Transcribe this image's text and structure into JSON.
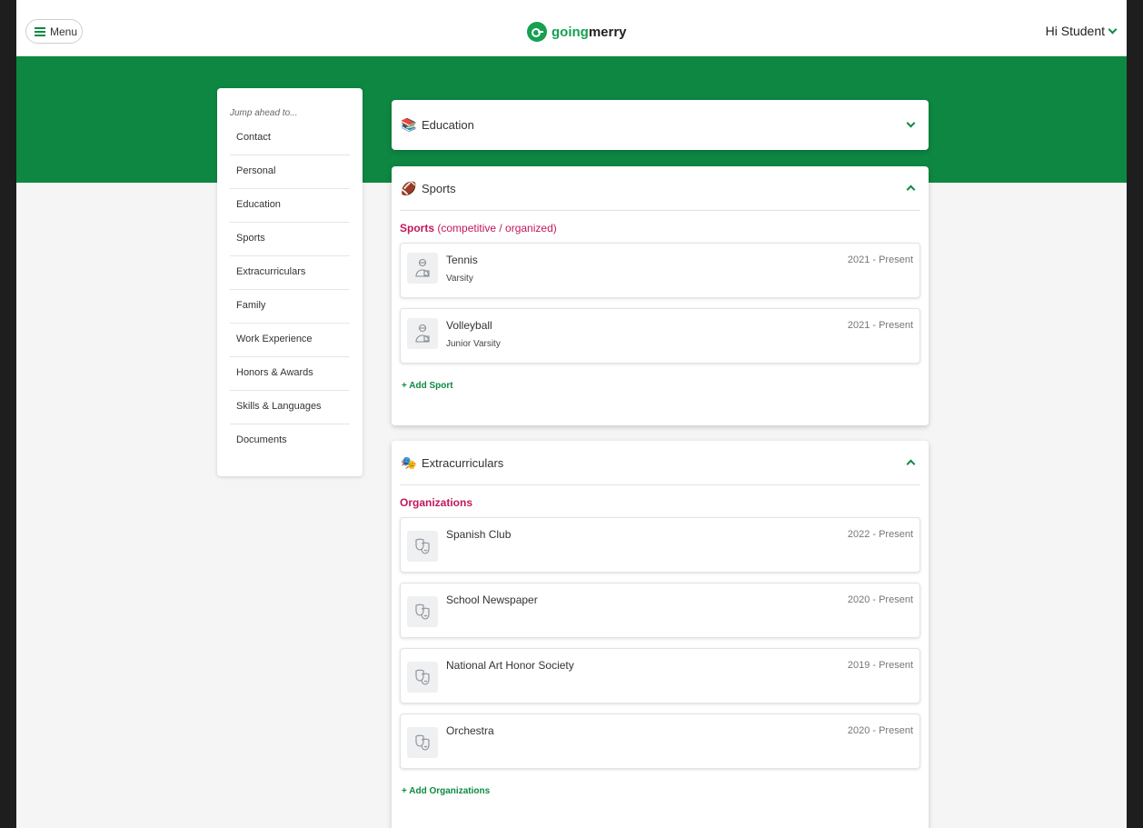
{
  "header": {
    "menu_label": "Menu",
    "logo_going": "going",
    "logo_merry": "merry",
    "greeting": "Hi Student"
  },
  "sidenav": {
    "heading": "Jump ahead to...",
    "items": [
      {
        "label": "Contact"
      },
      {
        "label": "Personal"
      },
      {
        "label": "Education"
      },
      {
        "label": "Sports"
      },
      {
        "label": "Extracurriculars"
      },
      {
        "label": "Family"
      },
      {
        "label": "Work Experience"
      },
      {
        "label": "Honors & Awards"
      },
      {
        "label": "Skills & Languages"
      },
      {
        "label": "Documents"
      }
    ]
  },
  "education": {
    "title": "Education",
    "icon": "books-icon"
  },
  "sports": {
    "title": "Sports",
    "icon": "football-icon",
    "section_bold": "Sports",
    "section_rest": " (competitive / organized)",
    "items": [
      {
        "name": "Tennis",
        "level": "Varsity",
        "dates": "2021 - Present"
      },
      {
        "name": "Volleyball",
        "level": "Junior Varsity",
        "dates": "2021 - Present"
      }
    ],
    "add_label": "+ Add Sport"
  },
  "extracurriculars": {
    "title": "Extracurriculars",
    "icon": "theater-masks-icon",
    "section_label": "Organizations",
    "items": [
      {
        "name": "Spanish Club",
        "dates": "2022 - Present"
      },
      {
        "name": "School Newspaper",
        "dates": "2020 - Present"
      },
      {
        "name": "National Art Honor Society",
        "dates": "2019 - Present"
      },
      {
        "name": "Orchestra",
        "dates": "2020 - Present"
      }
    ],
    "add_label": "+ Add Organizations"
  },
  "colors": {
    "brand_green": "#0d8742",
    "accent_pink": "#c2185b"
  }
}
